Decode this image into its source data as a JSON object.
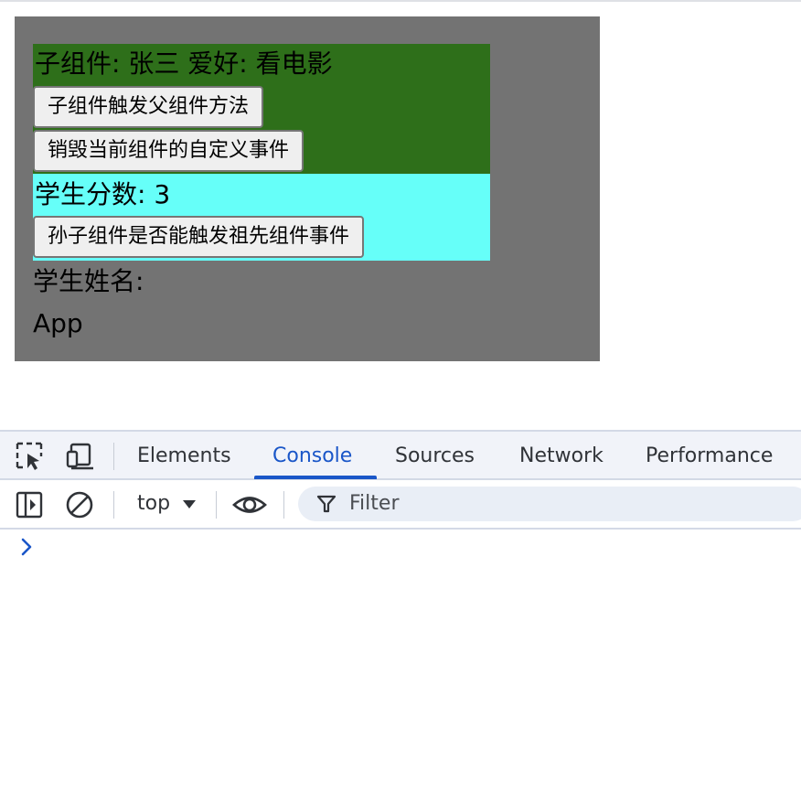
{
  "app": {
    "child": {
      "info": "子组件: 张三 爱好: 看电影",
      "button_trigger_parent": "子组件触发父组件方法",
      "button_destroy_events": "销毁当前组件的自定义事件"
    },
    "grandchild": {
      "score_text": "学生分数: 3",
      "button_trigger_ancestor": "孙子组件是否能触发祖先组件事件"
    },
    "student_name_label": "学生姓名:",
    "app_label": "App",
    "colors": {
      "app_bg": "#737373",
      "child_bg": "#2e6f1a",
      "grandchild_bg": "#66fff9"
    }
  },
  "devtools": {
    "tabs": [
      {
        "label": "Elements",
        "active": false
      },
      {
        "label": "Console",
        "active": true
      },
      {
        "label": "Sources",
        "active": false
      },
      {
        "label": "Network",
        "active": false
      },
      {
        "label": "Performance",
        "active": false
      }
    ],
    "context_selector": "top",
    "filter_placeholder": "Filter",
    "accent_color": "#1a56c8",
    "icons": {
      "inspect": "inspect-element-icon",
      "device": "device-toolbar-icon",
      "sidebar": "sidebar-toggle-icon",
      "clear": "clear-console-icon",
      "eye": "live-expression-icon",
      "filter": "filter-icon",
      "prompt": "console-prompt-icon"
    }
  }
}
